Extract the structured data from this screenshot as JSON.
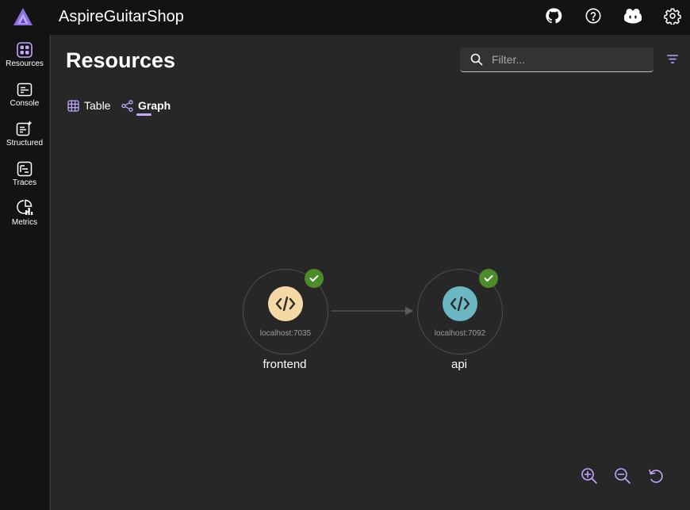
{
  "app": {
    "title": "AspireGuitarShop"
  },
  "header_icons": [
    "github-icon",
    "help-icon",
    "copilot-icon",
    "settings-icon"
  ],
  "sidebar": {
    "items": [
      {
        "label": "Resources",
        "icon": "resources-icon",
        "selected": true
      },
      {
        "label": "Console",
        "icon": "console-icon"
      },
      {
        "label": "Structured",
        "icon": "structured-logs-icon"
      },
      {
        "label": "Traces",
        "icon": "traces-icon"
      },
      {
        "label": "Metrics",
        "icon": "metrics-icon"
      }
    ]
  },
  "main": {
    "title": "Resources",
    "search": {
      "placeholder": "Filter...",
      "value": ""
    },
    "tabs": [
      {
        "label": "Table",
        "icon": "grid-icon",
        "selected": false
      },
      {
        "label": "Graph",
        "icon": "graph-icon",
        "selected": true
      }
    ]
  },
  "graph": {
    "nodes": [
      {
        "name": "frontend",
        "endpoint": "localhost:7035",
        "status": "running",
        "color": "#f5d9a4"
      },
      {
        "name": "api",
        "endpoint": "localhost:7092",
        "status": "running",
        "color": "#6bb8c2"
      }
    ],
    "edges": [
      {
        "from": "frontend",
        "to": "api"
      }
    ]
  },
  "controls": [
    "zoom-in-icon",
    "zoom-out-icon",
    "reset-view-icon"
  ],
  "colors": {
    "accent": "#c2a6ff",
    "status_ok": "#4c8c2a",
    "background": "#272727",
    "chrome": "#131313"
  }
}
